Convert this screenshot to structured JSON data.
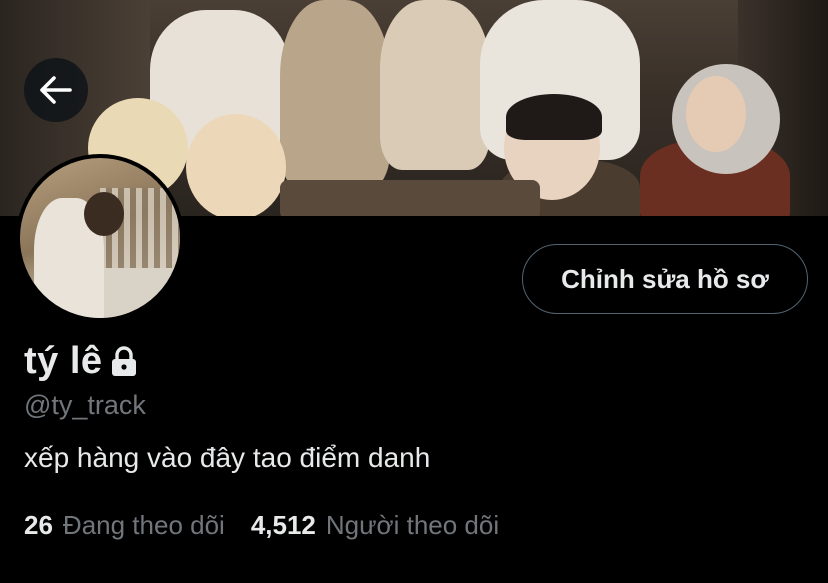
{
  "profile": {
    "display_name": "tý lê",
    "handle": "@ty_track",
    "bio": "xếp hàng vào đây tao điểm danh",
    "protected_icon": "lock-icon"
  },
  "actions": {
    "edit_profile_label": "Chỉnh sửa hồ sơ",
    "back_icon": "arrow-left-icon"
  },
  "stats": {
    "following_count": "26",
    "following_label": "Đang theo dõi",
    "followers_count": "4,512",
    "followers_label": "Người theo dõi"
  },
  "colors": {
    "background": "#000000",
    "primary_text": "#e7e9ea",
    "secondary_text": "#71767b",
    "button_border": "#536471"
  }
}
